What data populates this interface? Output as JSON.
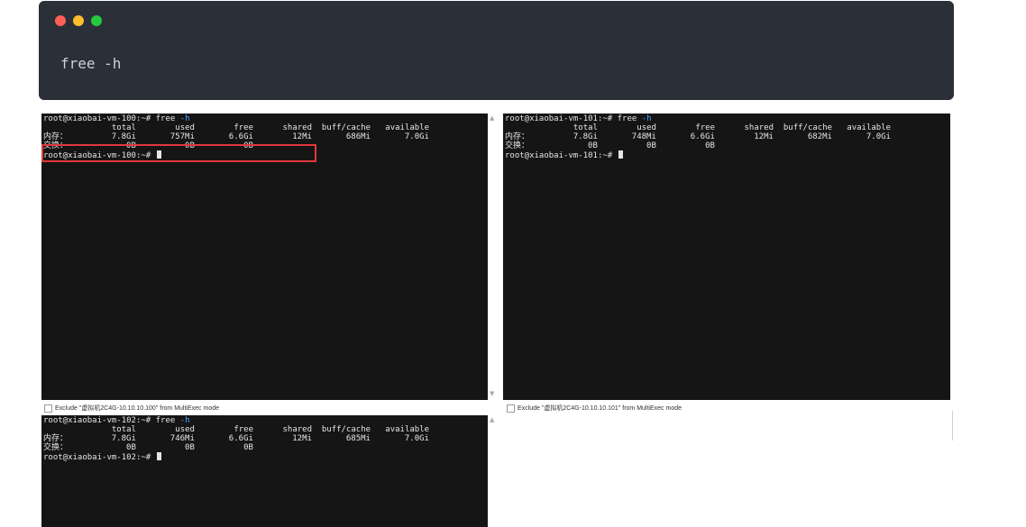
{
  "code_block": {
    "command": "free -h",
    "window_dots": [
      "#ff5f56",
      "#ffbd2e",
      "#27c93f"
    ]
  },
  "terminals": [
    {
      "name": "vm-100",
      "exclude_label": "Exclude \"虚拟机2C4G-10.10.10.100\" from MultiExec mode",
      "lines": [
        {
          "text": "root@xiaobai-vm-100:~# free ",
          "flag": "-h"
        },
        {
          "text": "              total        used        free      shared  buff/cache   available"
        },
        {
          "text": "内存：         7.8Gi       757Mi       6.6Gi        12Mi       686Mi       7.0Gi"
        },
        {
          "text": "交换：            0B          0B          0B"
        },
        {
          "text": "root@xiaobai-vm-100:~# ",
          "cursor": true
        }
      ]
    },
    {
      "name": "vm-101",
      "exclude_label": "Exclude \"虚拟机2C4G-10.10.10.101\" from MultiExec mode",
      "lines": [
        {
          "text": "root@xiaobai-vm-101:~# free ",
          "flag": "-h"
        },
        {
          "text": "              total        used        free      shared  buff/cache   available"
        },
        {
          "text": "内存：         7.8Gi       748Mi       6.6Gi        12Mi       682Mi       7.0Gi"
        },
        {
          "text": "交换：            0B          0B          0B"
        },
        {
          "text": "root@xiaobai-vm-101:~# ",
          "cursor": true
        }
      ]
    },
    {
      "name": "vm-102",
      "lines": [
        {
          "text": "root@xiaobai-vm-102:~# free ",
          "flag": "-h"
        },
        {
          "text": "              total        used        free      shared  buff/cache   available"
        },
        {
          "text": "内存：         7.8Gi       746Mi       6.6Gi        12Mi       685Mi       7.0Gi"
        },
        {
          "text": "交换：            0B          0B          0B"
        },
        {
          "text": "root@xiaobai-vm-102:~# ",
          "cursor": true
        }
      ]
    }
  ],
  "scrollbar": {
    "up_arrow": "▲",
    "down_arrow": "▼"
  },
  "highlight_color": "#e0393e"
}
